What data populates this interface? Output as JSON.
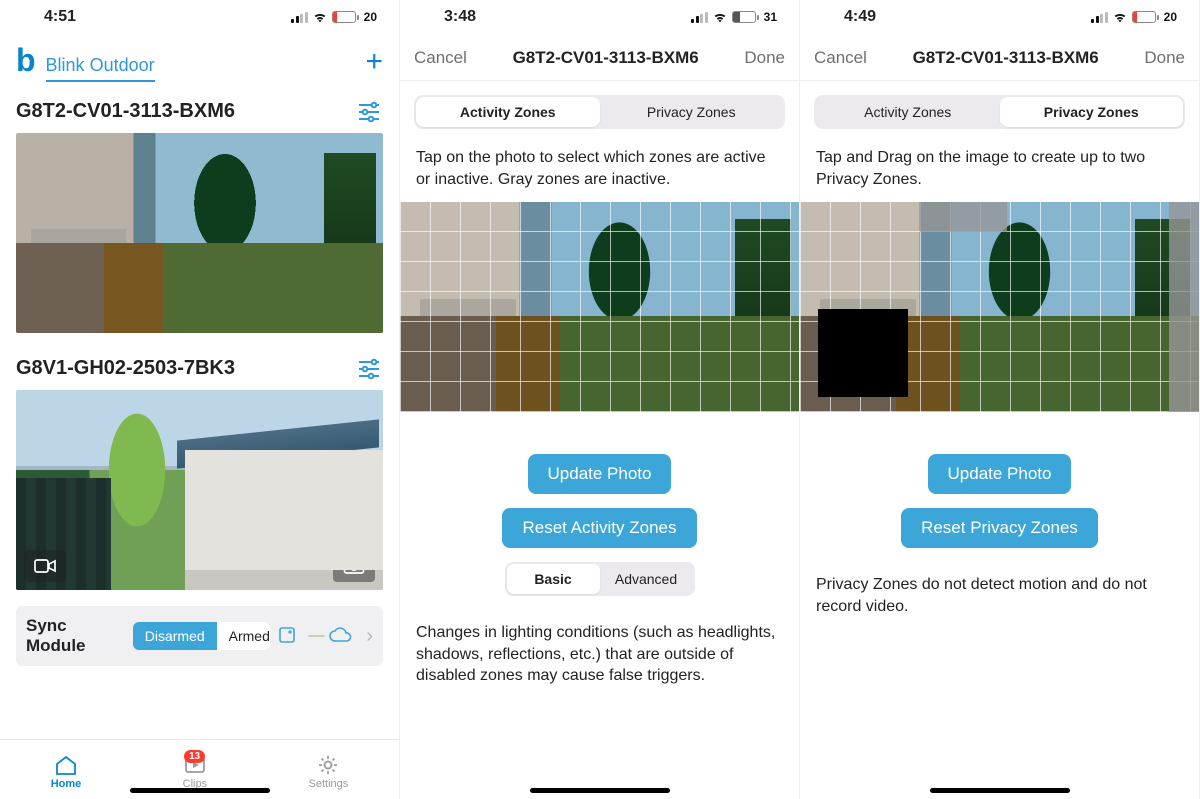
{
  "screen1": {
    "status": {
      "time": "4:51",
      "battery_pct": 20
    },
    "brand_letter": "b",
    "brand_title": "Blink Outdoor",
    "cameras": [
      {
        "name": "G8T2-CV01-3113-BXM6"
      },
      {
        "name": "G8V1-GH02-2503-7BK3"
      }
    ],
    "sync_label": "Sync Module",
    "arm_segment": {
      "disarmed": "Disarmed",
      "armed": "Armed",
      "selected": "Disarmed"
    },
    "tabs": {
      "home": "Home",
      "clips": "Clips",
      "settings": "Settings",
      "clips_badge": 13
    }
  },
  "screen2": {
    "status": {
      "time": "3:48",
      "battery_pct": 31
    },
    "nav": {
      "cancel": "Cancel",
      "title": "G8T2-CV01-3113-BXM6",
      "done": "Done"
    },
    "segment": {
      "activity": "Activity Zones",
      "privacy": "Privacy Zones",
      "selected": "Activity Zones"
    },
    "help": "Tap on the photo to select which zones are active or inactive. Gray zones are inactive.",
    "update_btn": "Update Photo",
    "reset_btn": "Reset Activity Zones",
    "mode_segment": {
      "basic": "Basic",
      "advanced": "Advanced",
      "selected": "Basic"
    },
    "body": "Changes in lighting conditions (such as headlights, shadows, reflections, etc.) that are outside of disabled zones may cause false triggers."
  },
  "screen3": {
    "status": {
      "time": "4:49",
      "battery_pct": 20
    },
    "nav": {
      "cancel": "Cancel",
      "title": "G8T2-CV01-3113-BXM6",
      "done": "Done"
    },
    "segment": {
      "activity": "Activity Zones",
      "privacy": "Privacy Zones",
      "selected": "Privacy Zones"
    },
    "help": "Tap and Drag on the image to create up to two Privacy Zones.",
    "update_btn": "Update Photo",
    "reset_btn": "Reset Privacy Zones",
    "body": "Privacy Zones do not detect motion and do not record video."
  }
}
